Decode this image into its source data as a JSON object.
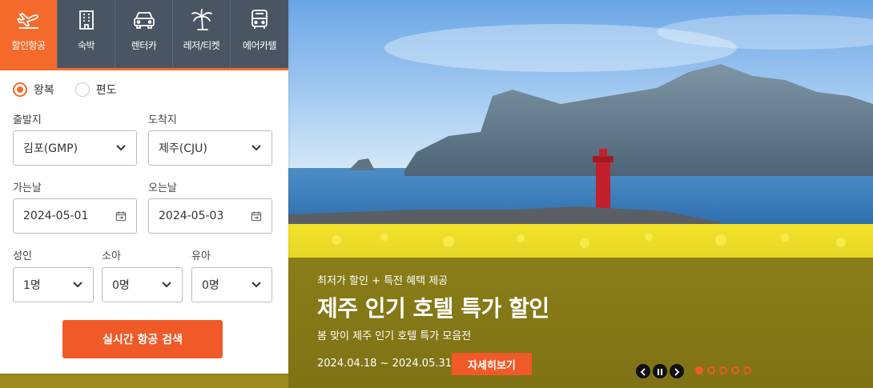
{
  "tabs": [
    {
      "label": "할인항공",
      "icon": "airplane-icon",
      "active": true
    },
    {
      "label": "숙박",
      "icon": "hotel-icon",
      "active": false
    },
    {
      "label": "렌터카",
      "icon": "car-icon",
      "active": false
    },
    {
      "label": "레저/티켓",
      "icon": "palm-tree-icon",
      "active": false
    },
    {
      "label": "에어카텔",
      "icon": "bus-icon",
      "active": false
    }
  ],
  "trip_type": {
    "round_trip": "왕복",
    "one_way": "편도",
    "selected": "왕복"
  },
  "fields": {
    "departure_label": "출발지",
    "departure_value": "김포(GMP)",
    "arrival_label": "도착지",
    "arrival_value": "제주(CJU)",
    "depart_date_label": "가는날",
    "depart_date_value": "2024-05-01",
    "return_date_label": "오는날",
    "return_date_value": "2024-05-03",
    "adult_label": "성인",
    "adult_value": "1명",
    "child_label": "소아",
    "child_value": "0명",
    "infant_label": "유아",
    "infant_value": "0명"
  },
  "search_button": "실시간 항공 검색",
  "banner": {
    "subtitle": "최저가 할인 + 특전 혜택 제공",
    "headline": "제주 인기 호텔 특가 할인",
    "description": "봄 맞이 제주 인기 호텔 특가 모음전",
    "period": "2024.04.18 ~ 2024.05.31",
    "more_button": "자세히보기",
    "slide_count": 5,
    "active_slide": 1
  },
  "colors": {
    "accent": "#f05a28",
    "tab_bg": "#4a5563",
    "banner_overlay": "#6e6414"
  }
}
